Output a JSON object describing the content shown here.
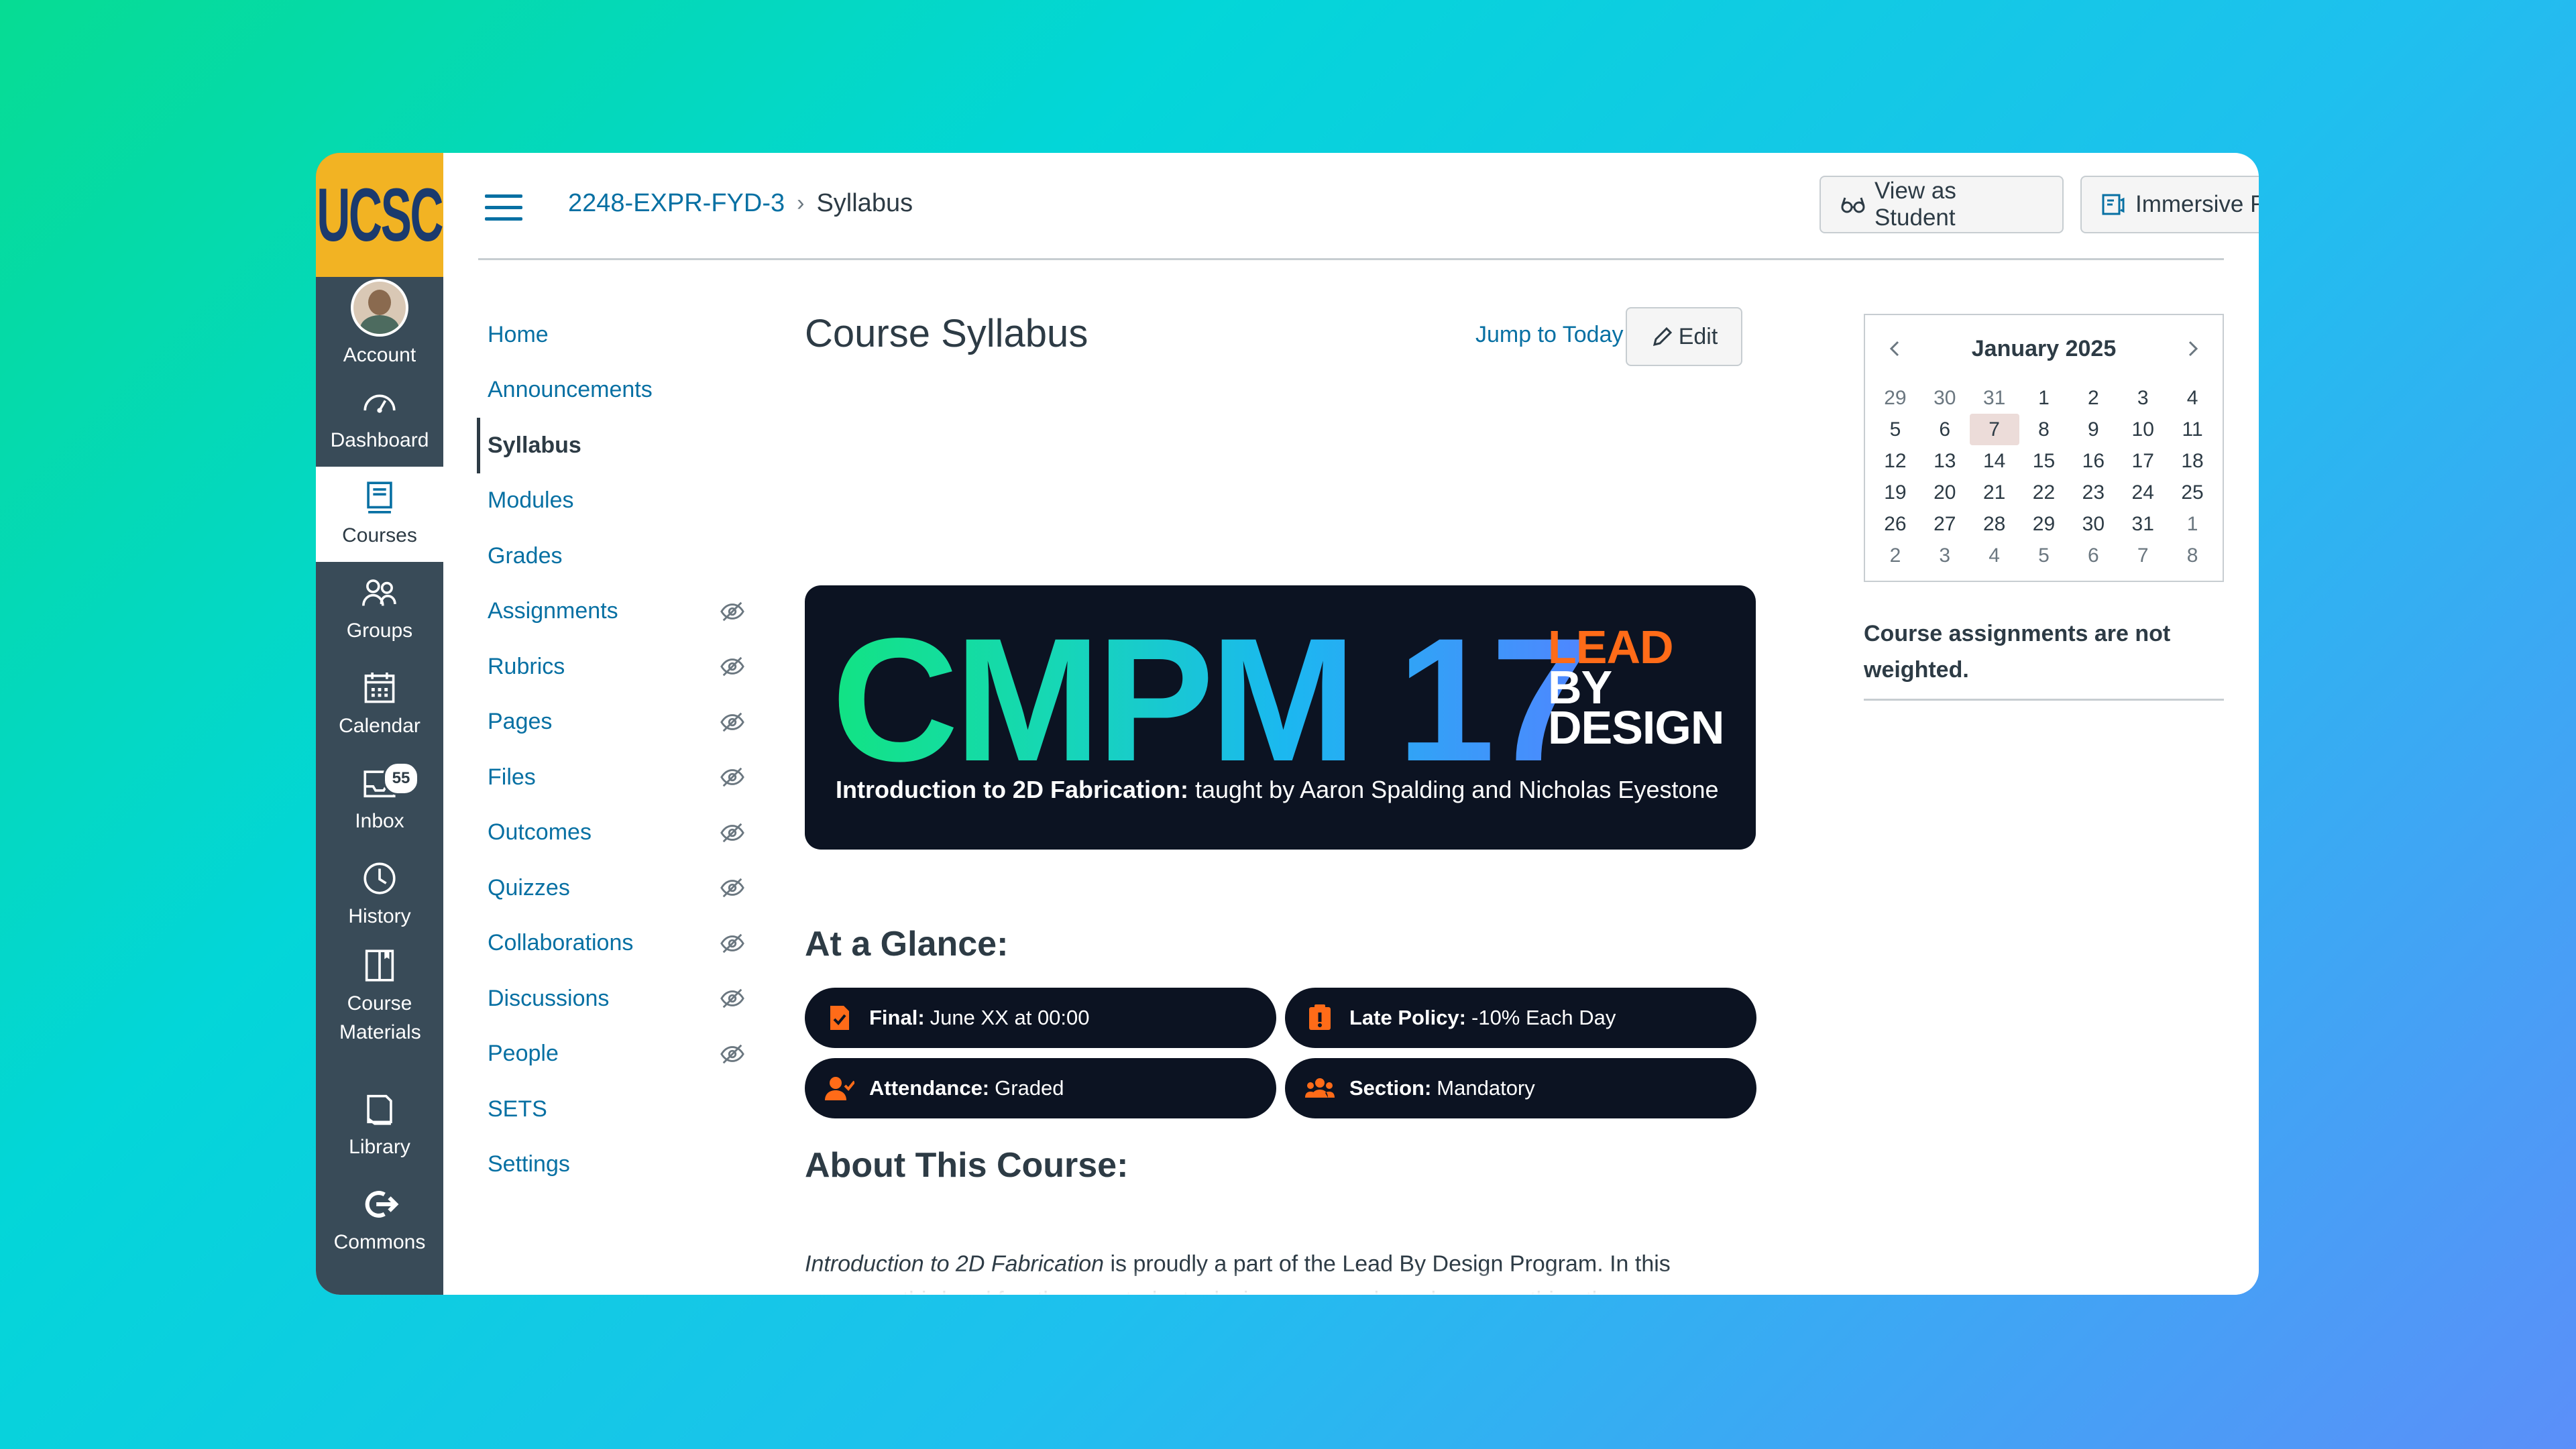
{
  "global_nav": {
    "logo_text": "UCSC",
    "items": [
      {
        "label": "Account",
        "icon": "account-avatar"
      },
      {
        "label": "Dashboard",
        "icon": "dashboard-icon"
      },
      {
        "label": "Courses",
        "icon": "courses-icon",
        "active": true
      },
      {
        "label": "Groups",
        "icon": "groups-icon"
      },
      {
        "label": "Calendar",
        "icon": "calendar-icon"
      },
      {
        "label": "Inbox",
        "icon": "inbox-icon",
        "badge": "55"
      },
      {
        "label": "History",
        "icon": "history-icon"
      },
      {
        "label": "Course Materials",
        "icon": "course-materials-icon"
      },
      {
        "label": "Library",
        "icon": "library-icon"
      },
      {
        "label": "Commons",
        "icon": "commons-icon"
      }
    ]
  },
  "header": {
    "breadcrumb_course": "2248-EXPR-FYD-3",
    "breadcrumb_separator": "›",
    "breadcrumb_page": "Syllabus",
    "view_as_student": "View as Student",
    "immersive_reader": "Immersive Reader"
  },
  "course_nav": [
    {
      "label": "Home",
      "hidden": false
    },
    {
      "label": "Announcements",
      "hidden": false
    },
    {
      "label": "Syllabus",
      "hidden": false,
      "active": true
    },
    {
      "label": "Modules",
      "hidden": false
    },
    {
      "label": "Grades",
      "hidden": false
    },
    {
      "label": "Assignments",
      "hidden": true
    },
    {
      "label": "Rubrics",
      "hidden": true
    },
    {
      "label": "Pages",
      "hidden": true
    },
    {
      "label": "Files",
      "hidden": true
    },
    {
      "label": "Outcomes",
      "hidden": true
    },
    {
      "label": "Quizzes",
      "hidden": true
    },
    {
      "label": "Collaborations",
      "hidden": true
    },
    {
      "label": "Discussions",
      "hidden": true
    },
    {
      "label": "People",
      "hidden": true
    },
    {
      "label": "SETS",
      "hidden": false
    },
    {
      "label": "Settings",
      "hidden": false
    }
  ],
  "main": {
    "title": "Course Syllabus",
    "jump_to_today": "Jump to Today",
    "edit": "Edit",
    "banner": {
      "course_code": "CMPM 17",
      "tagline_line1": "LEAD",
      "tagline_line2": "BY",
      "tagline_line3": "DESIGN",
      "subtitle_bold": "Introduction to 2D Fabrication:",
      "subtitle_rest": " taught by Aaron Spalding and Nicholas Eyestone",
      "accent_color": "#ff6b18"
    },
    "at_a_glance": {
      "heading": "At a Glance:",
      "items": [
        {
          "key": "Final:",
          "value": " June XX at 00:00",
          "icon": "calendar-check-icon"
        },
        {
          "key": "Late Policy:",
          "value": " -10% Each Day",
          "icon": "alert-clipboard-icon"
        },
        {
          "key": "Attendance:",
          "value": " Graded",
          "icon": "user-check-icon"
        },
        {
          "key": "Section:",
          "value": " Mandatory",
          "icon": "group-icon"
        }
      ]
    },
    "about": {
      "heading": "About This Course:",
      "italic_lead": "Introduction to 2D Fabrication",
      "body": " is proudly a part of the Lead By Design Program. In this program, third and fourth-year students design a course based on something they are passionate about. Throughout the building process, these future student-instructors learn what it takes to become a teacher, gain crucial leadership skills, and practice their skills before teaching in a subsequent quarter."
    }
  },
  "calendar": {
    "month": "January 2025",
    "today": "7",
    "days": [
      "29",
      "30",
      "31",
      "1",
      "2",
      "3",
      "4",
      "5",
      "6",
      "7",
      "8",
      "9",
      "10",
      "11",
      "12",
      "13",
      "14",
      "15",
      "16",
      "17",
      "18",
      "19",
      "20",
      "21",
      "22",
      "23",
      "24",
      "25",
      "26",
      "27",
      "28",
      "29",
      "30",
      "31",
      "1",
      "2",
      "3",
      "4",
      "5",
      "6",
      "7",
      "8"
    ]
  },
  "weighting_note": "Course assignments are not weighted.",
  "colors": {
    "brand_gold": "#f2b323",
    "link": "#0770a3",
    "nav_bg": "#394b58",
    "banner_bg": "#0c1322"
  }
}
